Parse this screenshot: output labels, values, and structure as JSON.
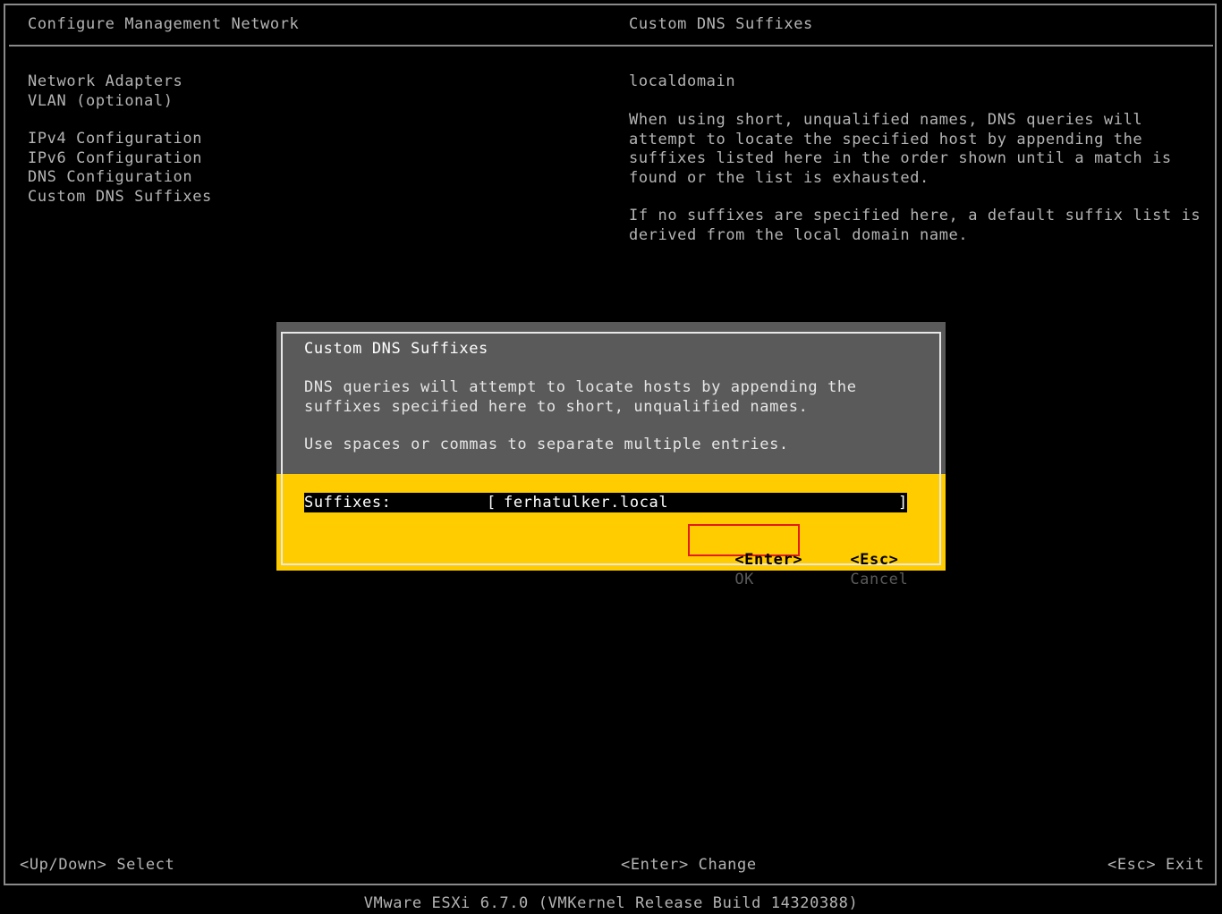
{
  "header": {
    "left_title": "Configure Management Network",
    "right_title": "Custom DNS Suffixes"
  },
  "menu": {
    "items": [
      "Network Adapters",
      "VLAN (optional)",
      "IPv4 Configuration",
      "IPv6 Configuration",
      "DNS Configuration",
      "Custom DNS Suffixes"
    ]
  },
  "detail": {
    "current_value": "localdomain",
    "para1": [
      "When using short, unqualified names, DNS queries will",
      "attempt to locate the specified host by appending the",
      "suffixes listed here in the order shown until a match is",
      "found or the list is exhausted."
    ],
    "para2": [
      "If no suffixes are specified here, a default suffix list is",
      "derived from the local domain name."
    ]
  },
  "dialog": {
    "title": "Custom DNS Suffixes",
    "desc1": [
      "DNS queries will attempt to locate hosts by appending the",
      "suffixes specified here to short, unqualified names."
    ],
    "desc2": "Use spaces or commas to separate multiple entries.",
    "field_label": "Suffixes:",
    "field_value": "ferhatulker.local",
    "bracket_open": "[",
    "bracket_close": "]",
    "ok_key": "<Enter>",
    "ok_label": "OK",
    "cancel_key": "<Esc>",
    "cancel_label": "Cancel",
    "highlight_color": "#e31b1b",
    "accent_color": "#ffcc00"
  },
  "footer": {
    "left": "<Up/Down> Select",
    "center": "<Enter> Change",
    "right": "<Esc> Exit"
  },
  "build": "VMware ESXi 6.7.0 (VMKernel Release Build 14320388)"
}
